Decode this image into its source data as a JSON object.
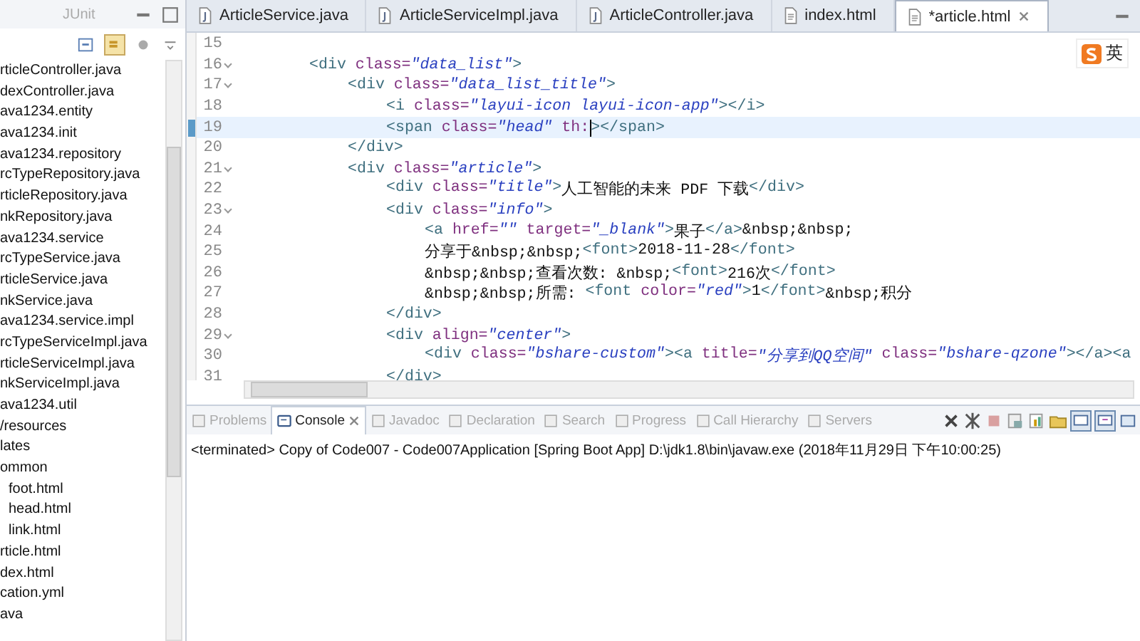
{
  "explorer": {
    "tab_label": "JUnit",
    "items": [
      {
        "label": "rticleController.java"
      },
      {
        "label": "dexController.java"
      },
      {
        "label": "ava1234.entity"
      },
      {
        "label": "ava1234.init"
      },
      {
        "label": "ava1234.repository"
      },
      {
        "label": "rcTypeRepository.java"
      },
      {
        "label": "rticleRepository.java"
      },
      {
        "label": "nkRepository.java"
      },
      {
        "label": "ava1234.service"
      },
      {
        "label": "rcTypeService.java"
      },
      {
        "label": "rticleService.java"
      },
      {
        "label": "nkService.java"
      },
      {
        "label": "ava1234.service.impl"
      },
      {
        "label": "rcTypeServiceImpl.java"
      },
      {
        "label": "rticleServiceImpl.java"
      },
      {
        "label": "nkServiceImpl.java"
      },
      {
        "label": "ava1234.util"
      },
      {
        "label": "/resources"
      },
      {
        "label": "lates"
      },
      {
        "label": "ommon",
        "children": [
          {
            "label": "foot.html"
          },
          {
            "label": "head.html"
          },
          {
            "label": "link.html"
          }
        ]
      },
      {
        "label": "rticle.html"
      },
      {
        "label": "dex.html"
      },
      {
        "label": "cation.yml"
      },
      {
        "label": "ava"
      }
    ]
  },
  "editor_tabs": [
    {
      "label": "ArticleService.java",
      "kind": "java",
      "selected": false
    },
    {
      "label": "ArticleServiceImpl.java",
      "kind": "java",
      "selected": false
    },
    {
      "label": "ArticleController.java",
      "kind": "java",
      "selected": false
    },
    {
      "label": "index.html",
      "kind": "html",
      "selected": false
    },
    {
      "label": "*article.html",
      "kind": "html",
      "selected": true
    }
  ],
  "ime_indicator": {
    "label": "英"
  },
  "code_lines": [
    {
      "number": "15",
      "fold": false,
      "current": false
    },
    {
      "number": "16",
      "fold": true,
      "current": false,
      "tokens": [
        {
          "kind": "tag",
          "text": "<div "
        },
        {
          "kind": "attr",
          "text": "class="
        },
        {
          "kind": "value",
          "text": "\"data_list\""
        },
        {
          "kind": "tag",
          "text": ">"
        }
      ],
      "children": [
        {
          "number": "17",
          "fold": true,
          "current": false,
          "tokens": [
            {
              "kind": "tag",
              "text": "<div "
            },
            {
              "kind": "attr",
              "text": "class="
            },
            {
              "kind": "value",
              "text": "\"data_list_title\""
            },
            {
              "kind": "tag",
              "text": ">"
            }
          ],
          "children": [
            {
              "number": "18",
              "fold": false,
              "current": false,
              "tokens": [
                {
                  "kind": "tag",
                  "text": "<i "
                },
                {
                  "kind": "attr",
                  "text": "class="
                },
                {
                  "kind": "value",
                  "text": "\"layui-icon layui-icon-app\""
                },
                {
                  "kind": "tag",
                  "text": "></i>"
                }
              ]
            },
            {
              "number": "19",
              "fold": false,
              "current": true,
              "tokens": [
                {
                  "kind": "tag",
                  "text": "<span "
                },
                {
                  "kind": "attr",
                  "text": "class="
                },
                {
                  "kind": "value",
                  "text": "\"head\""
                },
                {
                  "kind": "attr",
                  "text": " th:"
                },
                {
                  "kind": "tag",
                  "text": "></span>"
                }
              ]
            }
          ]
        },
        {
          "number": "20",
          "fold": false,
          "current": false,
          "tokens": [
            {
              "kind": "tag",
              "text": "</div>"
            }
          ]
        },
        {
          "number": "21",
          "fold": true,
          "current": false,
          "tokens": [
            {
              "kind": "tag",
              "text": "<div "
            },
            {
              "kind": "attr",
              "text": "class="
            },
            {
              "kind": "value",
              "text": "\"article\""
            },
            {
              "kind": "tag",
              "text": ">"
            }
          ],
          "children": [
            {
              "number": "22",
              "fold": false,
              "current": false,
              "tokens": [
                {
                  "kind": "tag",
                  "text": "<div "
                },
                {
                  "kind": "attr",
                  "text": "class="
                },
                {
                  "kind": "value",
                  "text": "\"title\""
                },
                {
                  "kind": "tag",
                  "text": ">"
                },
                {
                  "kind": "text",
                  "text": "人工智能的未来 PDF 下载"
                },
                {
                  "kind": "tag",
                  "text": "</div>"
                }
              ]
            },
            {
              "number": "23",
              "fold": true,
              "current": false,
              "tokens": [
                {
                  "kind": "tag",
                  "text": "<div "
                },
                {
                  "kind": "attr",
                  "text": "class="
                },
                {
                  "kind": "value",
                  "text": "\"info\""
                },
                {
                  "kind": "tag",
                  "text": ">"
                }
              ],
              "children": [
                {
                  "number": "24",
                  "fold": false,
                  "current": false,
                  "tokens": [
                    {
                      "kind": "tag",
                      "text": "<a "
                    },
                    {
                      "kind": "attr",
                      "text": "href="
                    },
                    {
                      "kind": "value",
                      "text": "\"\""
                    },
                    {
                      "kind": "attr",
                      "text": " target="
                    },
                    {
                      "kind": "value",
                      "text": "\"_blank\""
                    },
                    {
                      "kind": "tag",
                      "text": ">"
                    },
                    {
                      "kind": "text",
                      "text": "果子"
                    },
                    {
                      "kind": "tag",
                      "text": "</a>"
                    },
                    {
                      "kind": "text",
                      "text": "&nbsp;&nbsp;"
                    }
                  ]
                },
                {
                  "number": "25",
                  "fold": false,
                  "current": false,
                  "tokens": [
                    {
                      "kind": "text",
                      "text": "分享于&nbsp;&nbsp;"
                    },
                    {
                      "kind": "tag",
                      "text": "<font>"
                    },
                    {
                      "kind": "text",
                      "text": "2018-11-28"
                    },
                    {
                      "kind": "tag",
                      "text": "</font>"
                    }
                  ]
                },
                {
                  "number": "26",
                  "fold": false,
                  "current": false,
                  "tokens": [
                    {
                      "kind": "text",
                      "text": "&nbsp;&nbsp;查看次数: &nbsp;"
                    },
                    {
                      "kind": "tag",
                      "text": "<font>"
                    },
                    {
                      "kind": "text",
                      "text": "216次"
                    },
                    {
                      "kind": "tag",
                      "text": "</font>"
                    }
                  ]
                },
                {
                  "number": "27",
                  "fold": false,
                  "current": false,
                  "tokens": [
                    {
                      "kind": "text",
                      "text": "&nbsp;&nbsp;所需: "
                    },
                    {
                      "kind": "tag",
                      "text": "<font "
                    },
                    {
                      "kind": "attr",
                      "text": "color="
                    },
                    {
                      "kind": "value",
                      "text": "\"red\""
                    },
                    {
                      "kind": "tag",
                      "text": ">"
                    },
                    {
                      "kind": "text",
                      "text": "1"
                    },
                    {
                      "kind": "tag",
                      "text": "</font>"
                    },
                    {
                      "kind": "text",
                      "text": "&nbsp;积分"
                    }
                  ]
                }
              ]
            },
            {
              "number": "28",
              "fold": false,
              "current": false,
              "tokens": [
                {
                  "kind": "tag",
                  "text": "</div>"
                }
              ]
            },
            {
              "number": "29",
              "fold": true,
              "current": false,
              "tokens": [
                {
                  "kind": "tag",
                  "text": "<div "
                },
                {
                  "kind": "attr",
                  "text": "align="
                },
                {
                  "kind": "value",
                  "text": "\"center\""
                },
                {
                  "kind": "tag",
                  "text": ">"
                }
              ],
              "children": [
                {
                  "number": "30",
                  "fold": false,
                  "current": false,
                  "tokens": [
                    {
                      "kind": "tag",
                      "text": "<div "
                    },
                    {
                      "kind": "attr",
                      "text": "class="
                    },
                    {
                      "kind": "value",
                      "text": "\"bshare-custom\""
                    },
                    {
                      "kind": "tag",
                      "text": "><a "
                    },
                    {
                      "kind": "attr",
                      "text": "title="
                    },
                    {
                      "kind": "value",
                      "text": "\"分享到QQ空间\""
                    },
                    {
                      "kind": "attr",
                      "text": " class="
                    },
                    {
                      "kind": "value",
                      "text": "\"bshare-qzone\""
                    },
                    {
                      "kind": "tag",
                      "text": "></a><a"
                    }
                  ]
                }
              ]
            },
            {
              "number": "31",
              "fold": false,
              "current": false,
              "tokens": [
                {
                  "kind": "tag",
                  "text": "</div>"
                }
              ]
            }
          ]
        }
      ]
    }
  ],
  "bottom_tabs": [
    {
      "label": "Problems",
      "selected": false,
      "closable": false
    },
    {
      "label": "Console",
      "selected": true,
      "closable": true
    },
    {
      "label": "Javadoc",
      "selected": false,
      "closable": false
    },
    {
      "label": "Declaration",
      "selected": false,
      "closable": false
    },
    {
      "label": "Search",
      "selected": false,
      "closable": false
    },
    {
      "label": "Progress",
      "selected": false,
      "closable": false
    },
    {
      "label": "Call Hierarchy",
      "selected": false,
      "closable": false
    },
    {
      "label": "Servers",
      "selected": false,
      "closable": false
    }
  ],
  "console": {
    "text": "<terminated> Copy of Code007 - Code007Application [Spring Boot App] D:\\jdk1.8\\bin\\javaw.exe (2018年11月29日 下午10:00:25)"
  }
}
